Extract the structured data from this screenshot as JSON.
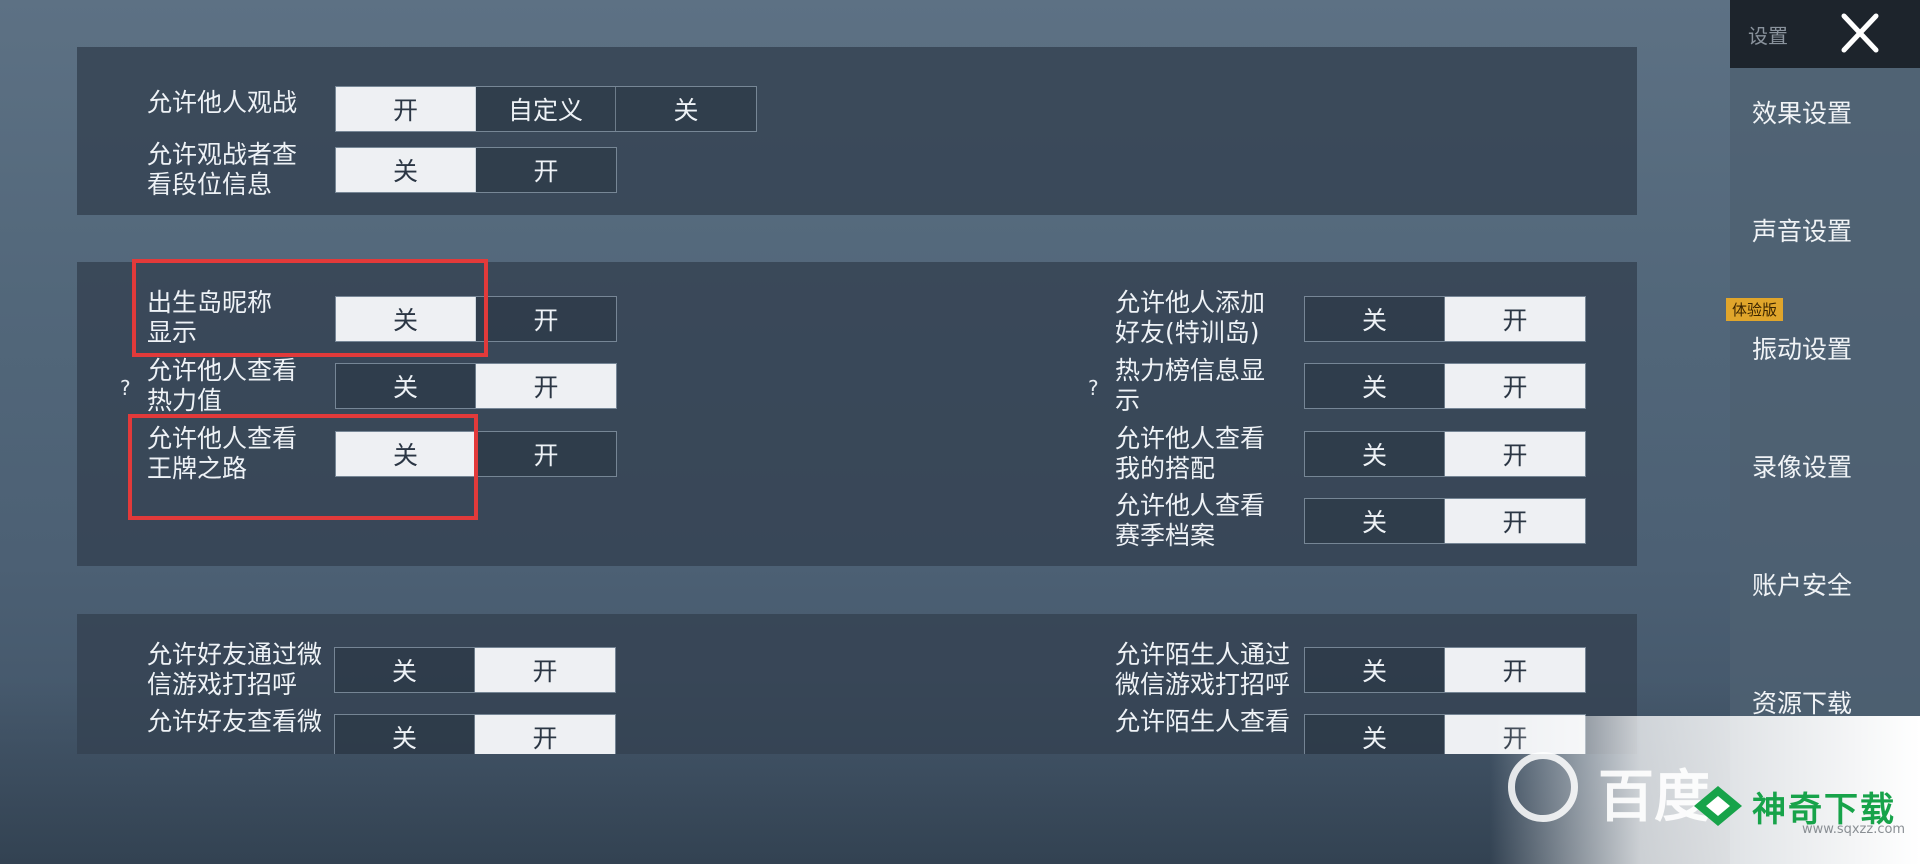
{
  "settings": {
    "section1": [
      {
        "label": "允许他人观战",
        "options": [
          "开",
          "自定义",
          "关"
        ],
        "selected": 0
      },
      {
        "label_line1": "允许观战者查",
        "label_line2": "看段位信息",
        "options": [
          "关",
          "开"
        ],
        "selected": 0
      }
    ],
    "section2_left": [
      {
        "label_line1": "出生岛昵称",
        "label_line2": "显示",
        "options": [
          "关",
          "开"
        ],
        "selected": 0
      },
      {
        "label_line1": "允许他人查看",
        "label_line2": "热力值",
        "options": [
          "关",
          "开"
        ],
        "selected": 1,
        "help": "?"
      },
      {
        "label_line1": "允许他人查看",
        "label_line2": "王牌之路",
        "options": [
          "关",
          "开"
        ],
        "selected": 0
      }
    ],
    "section2_right": [
      {
        "label_line1": "允许他人添加",
        "label_line2": "好友(特训岛)",
        "options": [
          "关",
          "开"
        ],
        "selected": 1
      },
      {
        "label_line1": "热力榜信息显",
        "label_line2": "示",
        "options": [
          "关",
          "开"
        ],
        "selected": 1,
        "help": "?"
      },
      {
        "label_line1": "允许他人查看",
        "label_line2": "我的搭配",
        "options": [
          "关",
          "开"
        ],
        "selected": 1
      },
      {
        "label_line1": "允许他人查看",
        "label_line2": "赛季档案",
        "options": [
          "关",
          "开"
        ],
        "selected": 1
      }
    ],
    "section3_left": [
      {
        "label_line1": "允许好友通过微",
        "label_line2": "信游戏打招呼",
        "options": [
          "关",
          "开"
        ],
        "selected": 1
      },
      {
        "label_line1": "允许好友查看微",
        "options": [
          "关",
          "开"
        ],
        "selected": 1
      }
    ],
    "section3_right": [
      {
        "label_line1": "允许陌生人通过",
        "label_line2": "微信游戏打招呼",
        "options": [
          "关",
          "开"
        ],
        "selected": 1
      },
      {
        "label_line1": "允许陌生人查看",
        "options": [
          "关",
          "开"
        ],
        "selected": 1
      }
    ]
  },
  "sidebar": {
    "title": "设置",
    "badge": "体验版",
    "items": [
      {
        "label": "效果设置"
      },
      {
        "label": "声音设置"
      },
      {
        "label": "振动设置"
      },
      {
        "label": "录像设置"
      },
      {
        "label": "账户安全"
      },
      {
        "label": "资源下载"
      }
    ]
  },
  "watermark": {
    "bai": "百度",
    "name": "神奇下载",
    "url": "www.sqxzz.com"
  },
  "colors": {
    "highlight": "#e23a3a",
    "selected_bg": "#eef0f3",
    "badge": "#e0a52b",
    "brand_green": "#17a34a"
  }
}
